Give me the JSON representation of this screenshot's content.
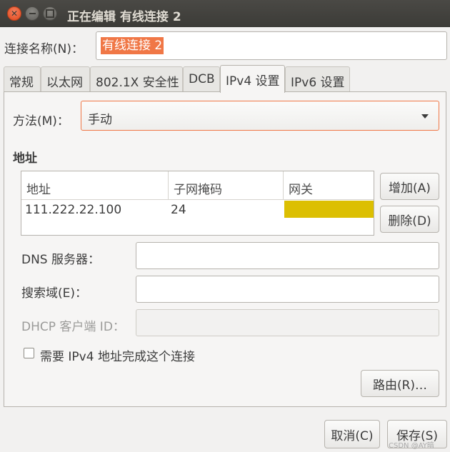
{
  "window": {
    "title": "正在编辑 有线连接 2",
    "close_glyph": "✕"
  },
  "connection_name": {
    "label": "连接名称(N)：",
    "value": "有线连接 2"
  },
  "tabs": [
    {
      "label": "常规"
    },
    {
      "label": "以太网"
    },
    {
      "label": "802.1X 安全性"
    },
    {
      "label": "DCB"
    },
    {
      "label": "IPv4 设置",
      "active": true
    },
    {
      "label": "IPv6 设置"
    }
  ],
  "ipv4": {
    "method_label": "方法(M)：",
    "method_value": "手动",
    "address_section_title": "地址",
    "address_table": {
      "headers": [
        "地址",
        "子网掩码",
        "网关"
      ],
      "rows": [
        [
          "111.222.22.100",
          "24",
          ""
        ]
      ]
    },
    "add_button": "增加(A)",
    "delete_button": "删除(D)",
    "dns_label": "DNS 服务器：",
    "dns_value": "",
    "search_domain_label": "搜索域(E)：",
    "search_domain_value": "",
    "dhcp_client_id_label": "DHCP 客户端 ID：",
    "dhcp_client_id_value": "",
    "require_ipv4_label": "需要 IPv4 地址完成这个连接",
    "require_ipv4_checked": false,
    "routes_button": "路由(R)…"
  },
  "footer": {
    "cancel_button": "取消(C)",
    "save_button": "保存(S)"
  },
  "watermark": "CSDN @AY暗",
  "colors": {
    "titlebar": "#3c3b37",
    "accent": "#f07746",
    "gateway_cell_highlight": "#dcbf02"
  }
}
